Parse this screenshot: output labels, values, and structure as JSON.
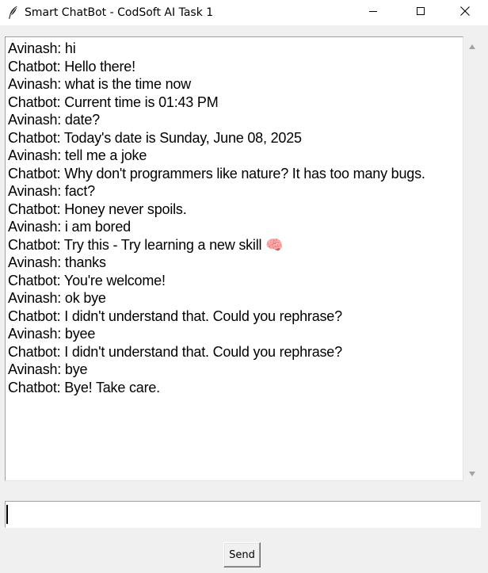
{
  "window": {
    "title": "Smart ChatBot - CodSoft AI Task 1"
  },
  "chat": {
    "lines": [
      "Avinash: hi",
      "Chatbot: Hello there!",
      "Avinash: what is the time now",
      "Chatbot: Current time is 01:43 PM",
      "Avinash: date?",
      "Chatbot: Today's date is Sunday, June 08, 2025",
      "Avinash: tell me a joke",
      "Chatbot: Why don't programmers like nature? It has too many bugs.",
      "Avinash: fact?",
      "Chatbot: Honey never spoils.",
      "Avinash: i am bored",
      "Chatbot: Try this - Try learning a new skill 🧠",
      "Avinash: thanks",
      "Chatbot: You're welcome!",
      "Avinash: ok bye",
      "Chatbot: I didn't understand that. Could you rephrase?",
      "Avinash: byee",
      "Chatbot: I didn't understand that. Could you rephrase?",
      "Avinash: bye",
      "Chatbot: Bye! Take care."
    ]
  },
  "input": {
    "value": ""
  },
  "send": {
    "label": "Send"
  },
  "icons": {
    "app": "feather-icon",
    "minimize": "minimize-icon",
    "maximize": "maximize-icon",
    "close": "close-icon",
    "scroll_up": "scroll-up-arrow-icon",
    "scroll_down": "scroll-down-arrow-icon"
  }
}
